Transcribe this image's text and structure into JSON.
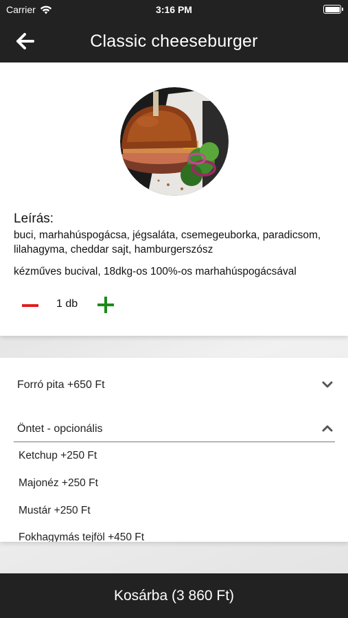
{
  "status_bar": {
    "carrier": "Carrier",
    "time": "3:16 PM"
  },
  "nav": {
    "title": "Classic cheeseburger",
    "back_icon": "arrow-left-icon"
  },
  "product": {
    "image_alt": "burger-photo",
    "description_heading": "Leírás:",
    "description": "buci, marhahúspogácsa, jégsaláta, csemegeuborka, paradicsom, lilahagyma, cheddar sajt, hamburgerszósz",
    "description_extra": "kézműves bucival, 18dkg-os 100%-os marhahúspogácsával",
    "quantity": "1 db"
  },
  "options": {
    "groups": [
      {
        "label": "Forró pita +650 Ft",
        "expanded": false
      },
      {
        "label": "Öntet - opcionális",
        "expanded": true
      }
    ],
    "choices": [
      "Ketchup +250 Ft",
      "Majonéz +250 Ft",
      "Mustár +250 Ft",
      "Fokhagymás tejföl +450 Ft"
    ]
  },
  "footer": {
    "cart_label": "Kosárba (3 860 Ft)"
  },
  "colors": {
    "bar": "#222222",
    "minus": "#e21b1b",
    "plus": "#1b8a1b"
  }
}
